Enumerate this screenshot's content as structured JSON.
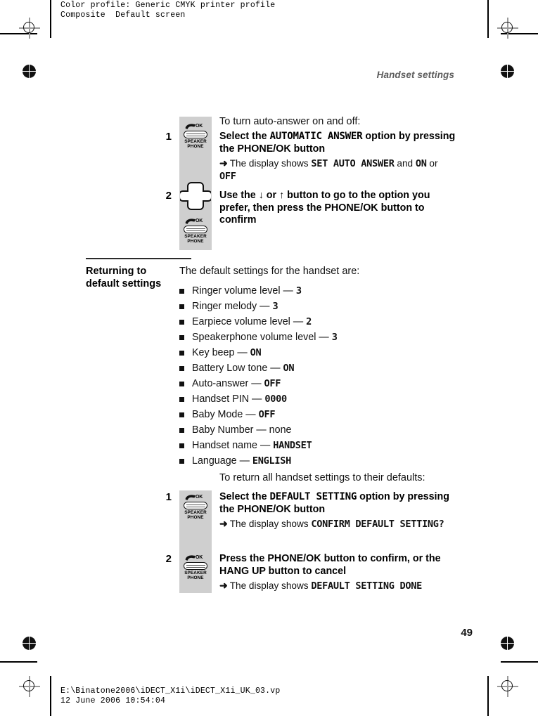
{
  "prepress": {
    "color_profile_line1": "Color profile: Generic CMYK printer profile",
    "color_profile_line2": "Composite  Default screen",
    "footer_path": "E:\\Binatone2006\\iDECT_X1i\\iDECT_X1i_UK_03.vp",
    "footer_timestamp": "12 June 2006 10:54:04"
  },
  "page": {
    "running_head": "Handset settings",
    "page_number": "49"
  },
  "key_labels": {
    "ok": "OK",
    "speaker_line1": "SPEAKER",
    "speaker_line2": "PHONE"
  },
  "procedure_auto_answer": {
    "lead_in": "To turn auto-answer on and off:",
    "steps": [
      {
        "number": "1",
        "instruction_pre": "Select the ",
        "instruction_lcd": "AUTOMATIC ANSWER",
        "instruction_mid": " option by pressing the ",
        "instruction_bold": "PHONE/OK",
        "instruction_post": " button",
        "result_arrow": "➜",
        "result_pre": "The display shows ",
        "result_lcd1": "SET AUTO ANSWER",
        "result_mid": " and ",
        "result_lcd2": "ON",
        "result_or": " or ",
        "result_lcd3": "OFF",
        "icon": "phone-ok-key-icon"
      },
      {
        "number": "2",
        "instruction_pre": "Use the ",
        "instruction_arrow_down": "↓",
        "instruction_or": " or ",
        "instruction_arrow_up": "↑",
        "instruction_mid": " button to go to the option you prefer, then press the ",
        "instruction_bold": "PHONE/OK",
        "instruction_post": " button to confirm",
        "icon": "nav-plus-key-icon"
      }
    ]
  },
  "section_defaults": {
    "heading": "Returning to default settings",
    "intro": "The default settings for the handset are:",
    "items": [
      {
        "label": "Ringer volume level",
        "dash": "—",
        "value": "3",
        "lcd": true
      },
      {
        "label": "Ringer melody",
        "dash": "—",
        "value": "3",
        "lcd": true
      },
      {
        "label": "Earpiece volume level",
        "dash": "—",
        "value": "2",
        "lcd": true
      },
      {
        "label": "Speakerphone volume level",
        "dash": "—",
        "value": "3",
        "lcd": true
      },
      {
        "label": "Key beep",
        "dash": "—",
        "value": "ON",
        "lcd": true
      },
      {
        "label": "Battery Low tone",
        "dash": "—",
        "value": "ON",
        "lcd": true
      },
      {
        "label": "Auto-answer",
        "dash": "—",
        "value": "OFF",
        "lcd": true
      },
      {
        "label": "Handset PIN",
        "dash": "—",
        "value": "0000",
        "lcd": true
      },
      {
        "label": "Baby Mode",
        "dash": "—",
        "value": "OFF",
        "lcd": true
      },
      {
        "label": "Baby Number",
        "dash": "—",
        "value": "none",
        "lcd": false
      },
      {
        "label": "Handset name",
        "dash": "—",
        "value": "HANDSET",
        "lcd": true
      },
      {
        "label": "Language",
        "dash": "—",
        "value": "ENGLISH",
        "lcd": true
      }
    ]
  },
  "procedure_reset": {
    "lead_in": "To return all handset settings to their defaults:",
    "steps": [
      {
        "number": "1",
        "instruction_pre": "Select the ",
        "instruction_lcd": "DEFAULT SETTING",
        "instruction_mid": " option by pressing the ",
        "instruction_bold": "PHONE/OK",
        "instruction_post": " button",
        "result_arrow": "➜",
        "result_pre": "The display shows ",
        "result_lcd1": "CONFIRM DEFAULT SETTING?",
        "icon": "phone-ok-key-icon"
      },
      {
        "number": "2",
        "instruction_pre": "Press the ",
        "instruction_bold": "PHONE/OK",
        "instruction_mid": " button to confirm, or the ",
        "instruction_bold2": "HANG UP",
        "instruction_post": " button to cancel",
        "result_arrow": "➜",
        "result_pre": "The display shows ",
        "result_lcd1": "DEFAULT SETTING DONE",
        "icon": "phone-ok-key-icon"
      }
    ]
  },
  "colors": {
    "key_rail_gray": "#cfcfcf",
    "running_head_gray": "#5c5c5c",
    "text_black": "#111111"
  }
}
